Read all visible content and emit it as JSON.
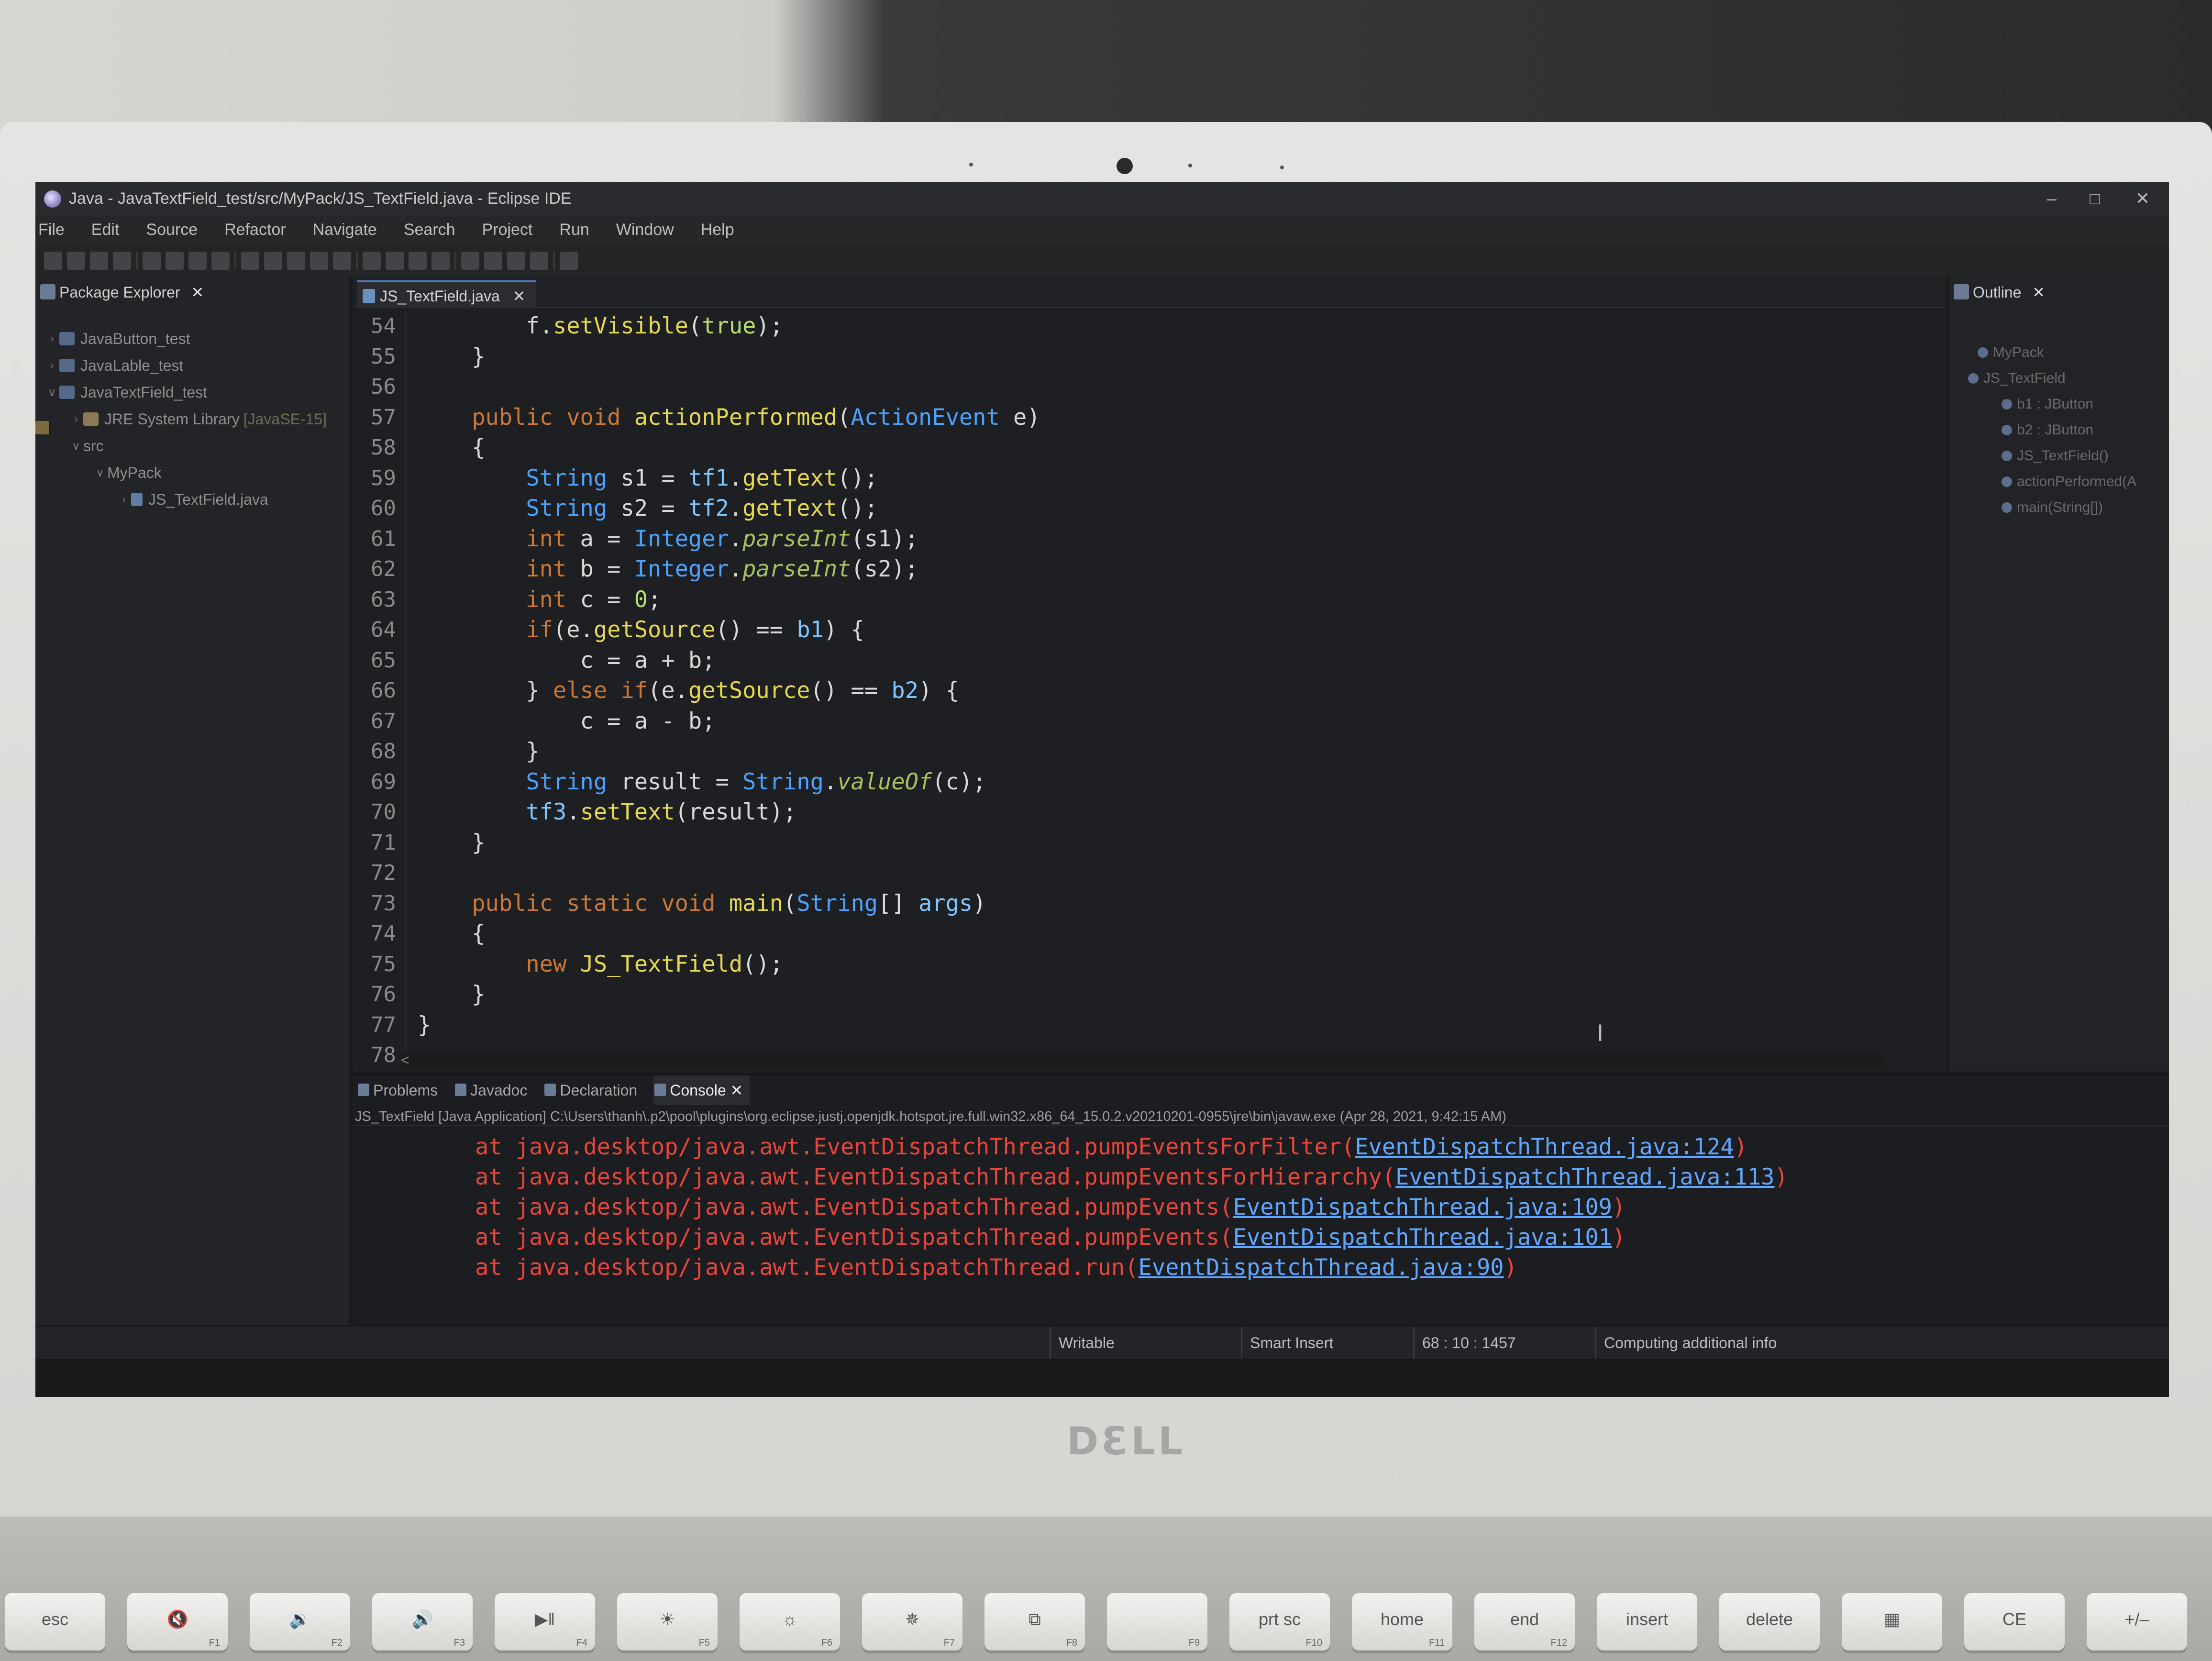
{
  "window": {
    "title": "Java - JavaTextField_test/src/MyPack/JS_TextField.java - Eclipse IDE",
    "minimize": "–",
    "maximize": "□",
    "close": "✕"
  },
  "menu": [
    "File",
    "Edit",
    "Source",
    "Refactor",
    "Navigate",
    "Search",
    "Project",
    "Run",
    "Window",
    "Help"
  ],
  "package_explorer": {
    "title": "Package Explorer",
    "close": "✕",
    "items": [
      {
        "arrow": "›",
        "label": "JavaButton_test",
        "hint": ""
      },
      {
        "arrow": "›",
        "label": "JavaLable_test",
        "hint": ""
      },
      {
        "arrow": "∨",
        "label": "JavaTextField_test",
        "hint": ""
      },
      {
        "arrow": "›",
        "label": "JRE System Library",
        "hint": "[JavaSE-15]"
      },
      {
        "arrow": "∨",
        "label": "src",
        "hint": ""
      },
      {
        "arrow": "∨",
        "label": "MyPack",
        "hint": ""
      },
      {
        "arrow": "›",
        "label": "JS_TextField.java",
        "hint": ""
      }
    ]
  },
  "editor": {
    "tab_label": "JS_TextField.java",
    "tab_close": "✕",
    "scroll_left": "<",
    "lines": [
      {
        "n": "54",
        "text": "        f.setVisible(true);"
      },
      {
        "n": "55",
        "text": "    }"
      },
      {
        "n": "56",
        "text": ""
      },
      {
        "n": "57",
        "text": "    public void actionPerformed(ActionEvent e)"
      },
      {
        "n": "58",
        "text": "    {"
      },
      {
        "n": "59",
        "text": "        String s1 = tf1.getText();"
      },
      {
        "n": "60",
        "text": "        String s2 = tf2.getText();"
      },
      {
        "n": "61",
        "text": "        int a = Integer.parseInt(s1);"
      },
      {
        "n": "62",
        "text": "        int b = Integer.parseInt(s2);"
      },
      {
        "n": "63",
        "text": "        int c = 0;"
      },
      {
        "n": "64",
        "text": "        if(e.getSource() == b1) {"
      },
      {
        "n": "65",
        "text": "            c = a + b;"
      },
      {
        "n": "66",
        "text": "        } else if(e.getSource() == b2) {"
      },
      {
        "n": "67",
        "text": "            c = a - b;"
      },
      {
        "n": "68",
        "text": "        }"
      },
      {
        "n": "69",
        "text": "        String result = String.valueOf(c);"
      },
      {
        "n": "70",
        "text": "        tf3.setText(result);"
      },
      {
        "n": "71",
        "text": "    }"
      },
      {
        "n": "72",
        "text": ""
      },
      {
        "n": "73",
        "text": "    public static void main(String[] args)"
      },
      {
        "n": "74",
        "text": "    {"
      },
      {
        "n": "75",
        "text": "        new JS_TextField();"
      },
      {
        "n": "76",
        "text": "    }"
      },
      {
        "n": "77",
        "text": "}"
      },
      {
        "n": "78",
        "text": ""
      }
    ]
  },
  "outline": {
    "title": "Outline",
    "close": "✕",
    "items": [
      "MyPack",
      "JS_TextField",
      "b1 : JButton",
      "b2 : JButton",
      "JS_TextField()",
      "actionPerformed(A",
      "main(String[])"
    ]
  },
  "bottom_panel": {
    "tabs": [
      "Problems",
      "Javadoc",
      "Declaration",
      "Console"
    ],
    "active_close": "✕",
    "process": "JS_TextField [Java Application] C:\\Users\\thanh\\.p2\\pool\\plugins\\org.eclipse.justj.openjdk.hotspot.jre.full.win32.x86_64_15.0.2.v20210201-0955\\jre\\bin\\javaw.exe  (Apr 28, 2021, 9:42:15 AM)",
    "console_lines": [
      {
        "text": "at java.desktop/java.awt.EventDispatchThread.pumpEventsForFilter(",
        "link": "EventDispatchThread.java:124",
        "end": ")"
      },
      {
        "text": "at java.desktop/java.awt.EventDispatchThread.pumpEventsForHierarchy(",
        "link": "EventDispatchThread.java:113",
        "end": ")"
      },
      {
        "text": "at java.desktop/java.awt.EventDispatchThread.pumpEvents(",
        "link": "EventDispatchThread.java:109",
        "end": ")"
      },
      {
        "text": "at java.desktop/java.awt.EventDispatchThread.pumpEvents(",
        "link": "EventDispatchThread.java:101",
        "end": ")"
      },
      {
        "text": "at java.desktop/java.awt.EventDispatchThread.run(",
        "link": "EventDispatchThread.java:90",
        "end": ")"
      }
    ]
  },
  "status": {
    "writable": "Writable",
    "insert_mode": "Smart Insert",
    "position": "68 : 10 : 1457",
    "progress": "Computing additional info"
  },
  "device": {
    "logo": "DƐLL",
    "keys": [
      {
        "label": "esc",
        "sub": ""
      },
      {
        "label": "🔇",
        "sub": "F1"
      },
      {
        "label": "🔉",
        "sub": "F2"
      },
      {
        "label": "🔊",
        "sub": "F3"
      },
      {
        "label": "▶‖",
        "sub": "F4"
      },
      {
        "label": "☀",
        "sub": "F5"
      },
      {
        "label": "☼",
        "sub": "F6"
      },
      {
        "label": "✵",
        "sub": "F7"
      },
      {
        "label": "⧉",
        "sub": "F8"
      },
      {
        "label": "",
        "sub": "F9"
      },
      {
        "label": "prt sc",
        "sub": "F10"
      },
      {
        "label": "home",
        "sub": "F11"
      },
      {
        "label": "end",
        "sub": "F12"
      },
      {
        "label": "insert",
        "sub": ""
      },
      {
        "label": "delete",
        "sub": ""
      },
      {
        "label": "▦",
        "sub": ""
      },
      {
        "label": "CE",
        "sub": ""
      },
      {
        "label": "+/–",
        "sub": ""
      }
    ]
  },
  "colors": {
    "keyword": "#cc7832",
    "type": "#4aa3ff",
    "method": "#e6d94a",
    "error": "#e8453c",
    "link": "#5fa8ff"
  }
}
